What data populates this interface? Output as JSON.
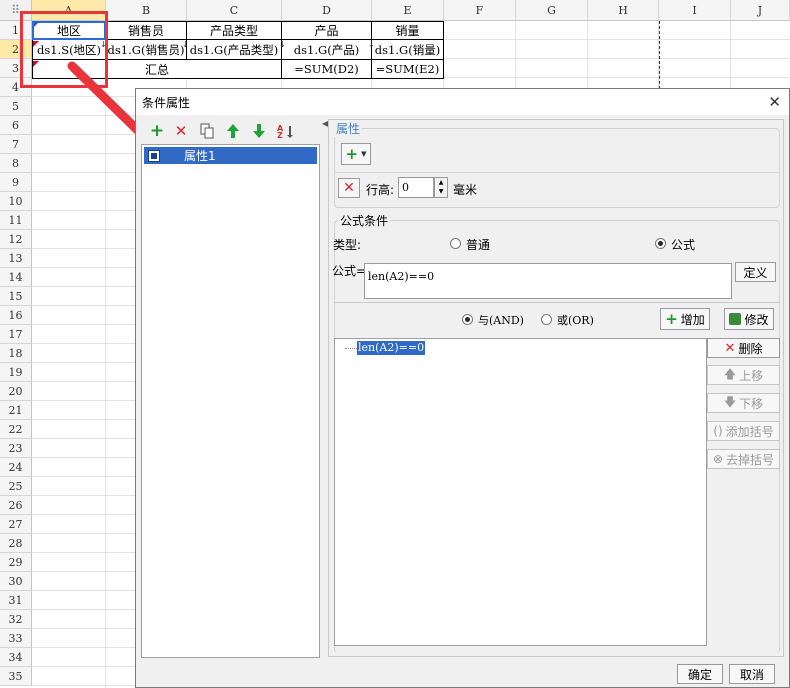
{
  "sheet": {
    "columns": [
      "A",
      "B",
      "C",
      "D",
      "E",
      "F",
      "G",
      "H",
      "I",
      "J"
    ],
    "rows": [
      "1",
      "2",
      "3",
      "4",
      "5",
      "6",
      "7",
      "8",
      "9",
      "10",
      "11",
      "12",
      "13",
      "14",
      "15",
      "16",
      "17",
      "18",
      "19",
      "20",
      "21",
      "22",
      "23",
      "24",
      "25",
      "26",
      "27",
      "28",
      "29",
      "30",
      "31",
      "32",
      "33",
      "34",
      "35"
    ],
    "row1": [
      "地区",
      "销售员",
      "产品类型",
      "产品",
      "销量"
    ],
    "row2": [
      "ds1.S(地区)",
      "ds1.G(销售员)",
      "ds1.G(产品类型)",
      "ds1.G(产品)",
      "ds1.G(销量)"
    ],
    "row3": {
      "total_label": "汇总",
      "d": "=SUM(D2)",
      "e": "=SUM(E2)"
    },
    "annotation_color": "#e8343a"
  },
  "dialog": {
    "title": "条件属性",
    "tree": {
      "item": "属性1"
    },
    "property_group": "属性",
    "row_height_label": "行高:",
    "row_height_value": "0",
    "row_height_unit": "毫米",
    "formula_group": "公式条件",
    "type_label": "类型:",
    "type_normal": "普通",
    "type_formula": "公式",
    "formula_label": "公式=",
    "formula_value": "len(A2)==0",
    "define_button": "定义",
    "and_label": "与(AND)",
    "or_label": "或(OR)",
    "add_button": "增加",
    "modify_button": "修改",
    "condition_item": "len(A2)==0",
    "delete_button": "删除",
    "up_button": "上移",
    "down_button": "下移",
    "add_bracket_button": "添加括号",
    "remove_bracket_button": "去掉括号",
    "ok_button": "确定",
    "cancel_button": "取消"
  }
}
